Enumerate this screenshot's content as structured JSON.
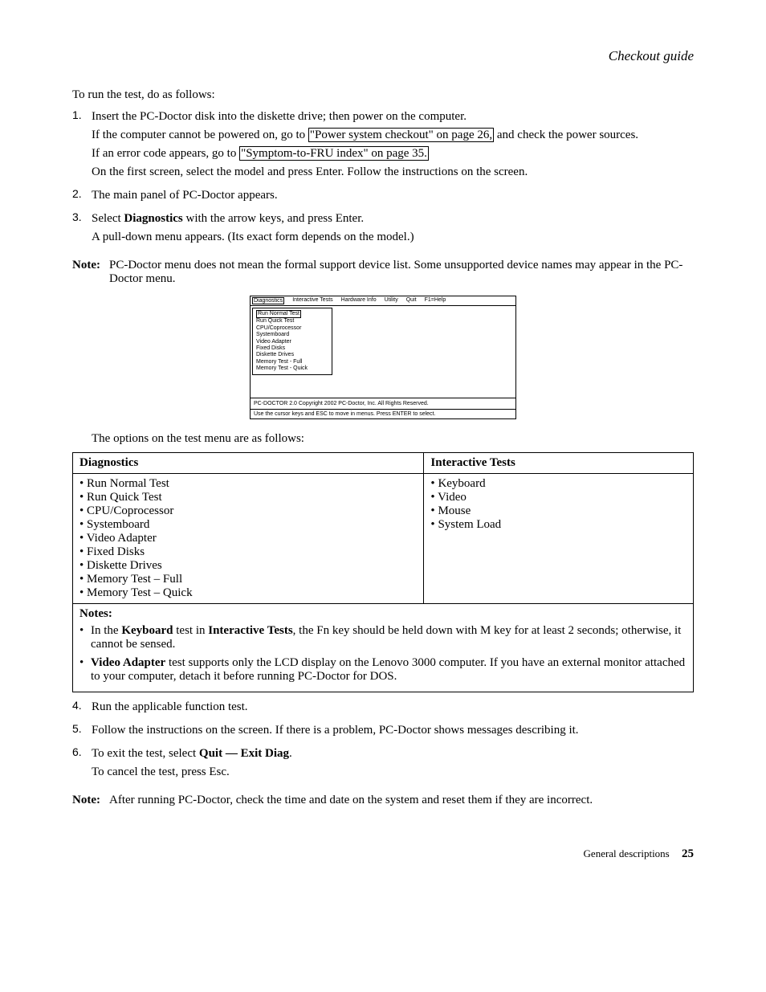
{
  "header": "Checkout guide",
  "intro": "To run the test, do as follows:",
  "steps_part1": [
    {
      "num": "1.",
      "lines": [
        {
          "type": "plain",
          "text": "Insert the PC-Doctor disk into the diskette drive; then power on the computer."
        },
        {
          "type": "link1",
          "pre": "If the computer cannot be powered on, go to ",
          "link": "\"Power system checkout\" on page 26,",
          "post": " and check the power sources."
        },
        {
          "type": "link2",
          "pre": "If an error code appears, go to ",
          "link": "\"Symptom-to-FRU index\" on page 35.",
          "post": ""
        },
        {
          "type": "plain",
          "text": "On the first screen, select the model and press Enter. Follow the instructions on the screen."
        }
      ]
    },
    {
      "num": "2.",
      "lines": [
        {
          "type": "plain",
          "text": "The main panel of PC-Doctor appears."
        }
      ]
    },
    {
      "num": "3.",
      "lines": [
        {
          "type": "sel",
          "pre": "Select ",
          "bold": "Diagnostics",
          "post": " with the arrow keys, and press Enter."
        },
        {
          "type": "plain",
          "text": "A pull-down menu appears. (Its exact form depends on the model.)"
        }
      ]
    }
  ],
  "note1": {
    "label": "Note:",
    "text": "PC-Doctor menu does not mean the formal support device list. Some unsupported device names may appear in the PC-Doctor menu."
  },
  "dos": {
    "menu": [
      "Diagnostics",
      "Interactive Tests",
      "Hardware Info",
      "Utility",
      "Quit",
      "F1=Help"
    ],
    "dropdown": [
      "Run Normal Test",
      "Run Quick Test",
      "CPU/Coprocessor",
      "Systemboard",
      "Video Adapter",
      "Fixed Disks",
      "Diskette Drives",
      "Memory Test - Full",
      "Memory Test - Quick"
    ],
    "status1": "PC-DOCTOR 2.0   Copyright 2002 PC-Doctor, Inc.   All Rights Reserved.",
    "status2": "Use the cursor keys and ESC to move in menus.  Press ENTER to select."
  },
  "options_intro": "The options on the test menu are as follows:",
  "table": {
    "head": [
      "Diagnostics",
      "Interactive Tests"
    ],
    "col1": [
      "Run Normal Test",
      "Run Quick Test",
      "CPU/Coprocessor",
      "Systemboard",
      "Video Adapter",
      "Fixed Disks",
      "Diskette Drives",
      "Memory Test – Full",
      "Memory Test – Quick"
    ],
    "col2": [
      "Keyboard",
      "Video",
      "Mouse",
      "System Load"
    ],
    "notes_label": "Notes:",
    "notes": [
      {
        "pre": "In the ",
        "b1": "Keyboard",
        "mid": " test in ",
        "b2": "Interactive Tests",
        "post": ", the Fn key should be held down with M key for at least 2 seconds; otherwise, it cannot be sensed."
      },
      {
        "b1": "Video Adapter",
        "post": " test supports only the LCD display on the Lenovo 3000 computer. If you have an external monitor attached to your computer, detach it before running PC-Doctor for DOS."
      }
    ]
  },
  "steps_part2": [
    {
      "num": "4.",
      "lines": [
        {
          "type": "plain",
          "text": "Run the applicable function test."
        }
      ]
    },
    {
      "num": "5.",
      "lines": [
        {
          "type": "plain",
          "text": "Follow the instructions on the screen. If there is a problem, PC-Doctor shows messages describing it."
        }
      ]
    },
    {
      "num": "6.",
      "lines": [
        {
          "type": "sel",
          "pre": "To exit the test, select ",
          "bold": "Quit — Exit Diag",
          "post": "."
        },
        {
          "type": "plain",
          "text": "To cancel the test, press Esc."
        }
      ]
    }
  ],
  "note2": {
    "label": "Note:",
    "text": "After running PC-Doctor, check the time and date on the system and reset them if they are incorrect."
  },
  "footer": {
    "text": "General descriptions",
    "page": "25"
  }
}
